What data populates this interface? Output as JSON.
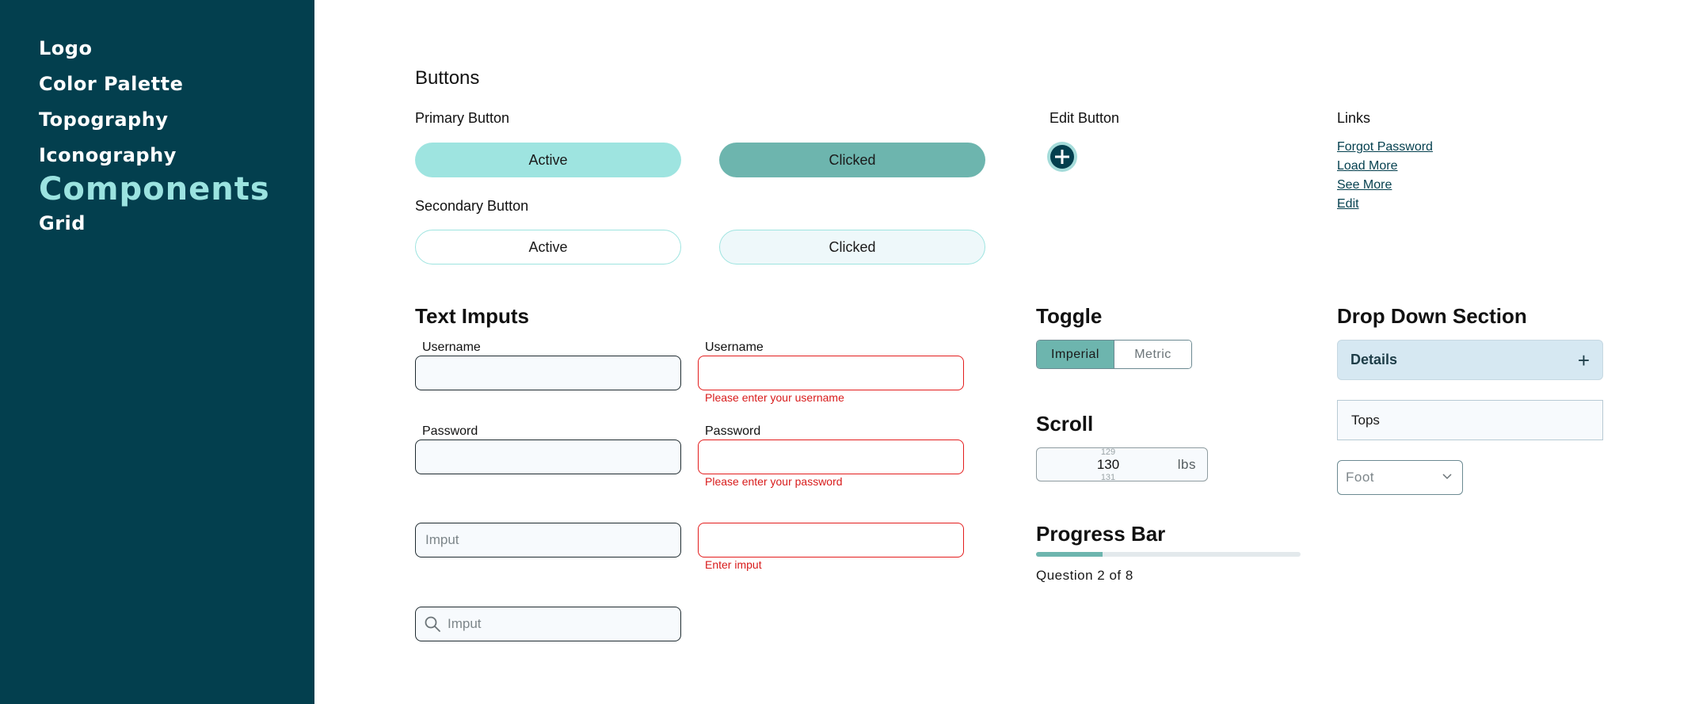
{
  "sidebar": {
    "items": [
      {
        "label": "Logo"
      },
      {
        "label": "Color Palette"
      },
      {
        "label": "Topography"
      },
      {
        "label": "Iconography"
      },
      {
        "label": "Components",
        "active": true
      },
      {
        "label": "Grid"
      }
    ]
  },
  "buttons": {
    "title": "Buttons",
    "primary_label": "Primary Button",
    "secondary_label": "Secondary Button",
    "active": "Active",
    "clicked": "Clicked",
    "edit_label": "Edit Button",
    "edit_icon": "plus-circle-icon"
  },
  "links": {
    "title": "Links",
    "items": [
      "Forgot Password",
      "Load More",
      "See More",
      "Edit"
    ]
  },
  "inputs": {
    "title": "Text Imputs",
    "username_label": "Username",
    "password_label": "Password",
    "placeholder": "Imput",
    "username_error": "Please enter your username",
    "password_error": "Please enter your password",
    "input_error": "Enter imput",
    "search_icon": "search-icon"
  },
  "toggle": {
    "title": "Toggle",
    "options": [
      "Imperial",
      "Metric"
    ],
    "selected": "Imperial"
  },
  "scroll": {
    "title": "Scroll",
    "prev": "129",
    "value": "130",
    "next": "131",
    "unit": "lbs"
  },
  "progress": {
    "title": "Progress Bar",
    "current": 2,
    "total": 8,
    "text": "Question 2 of 8"
  },
  "dropdown": {
    "title": "Drop Down Section",
    "header": "Details",
    "item": "Tops",
    "select_value": "Foot"
  },
  "colors": {
    "sidebar_bg": "#033f4e",
    "accent_light": "#9ee4e0",
    "accent_dark": "#6db5ae",
    "error": "#e31d1d"
  }
}
